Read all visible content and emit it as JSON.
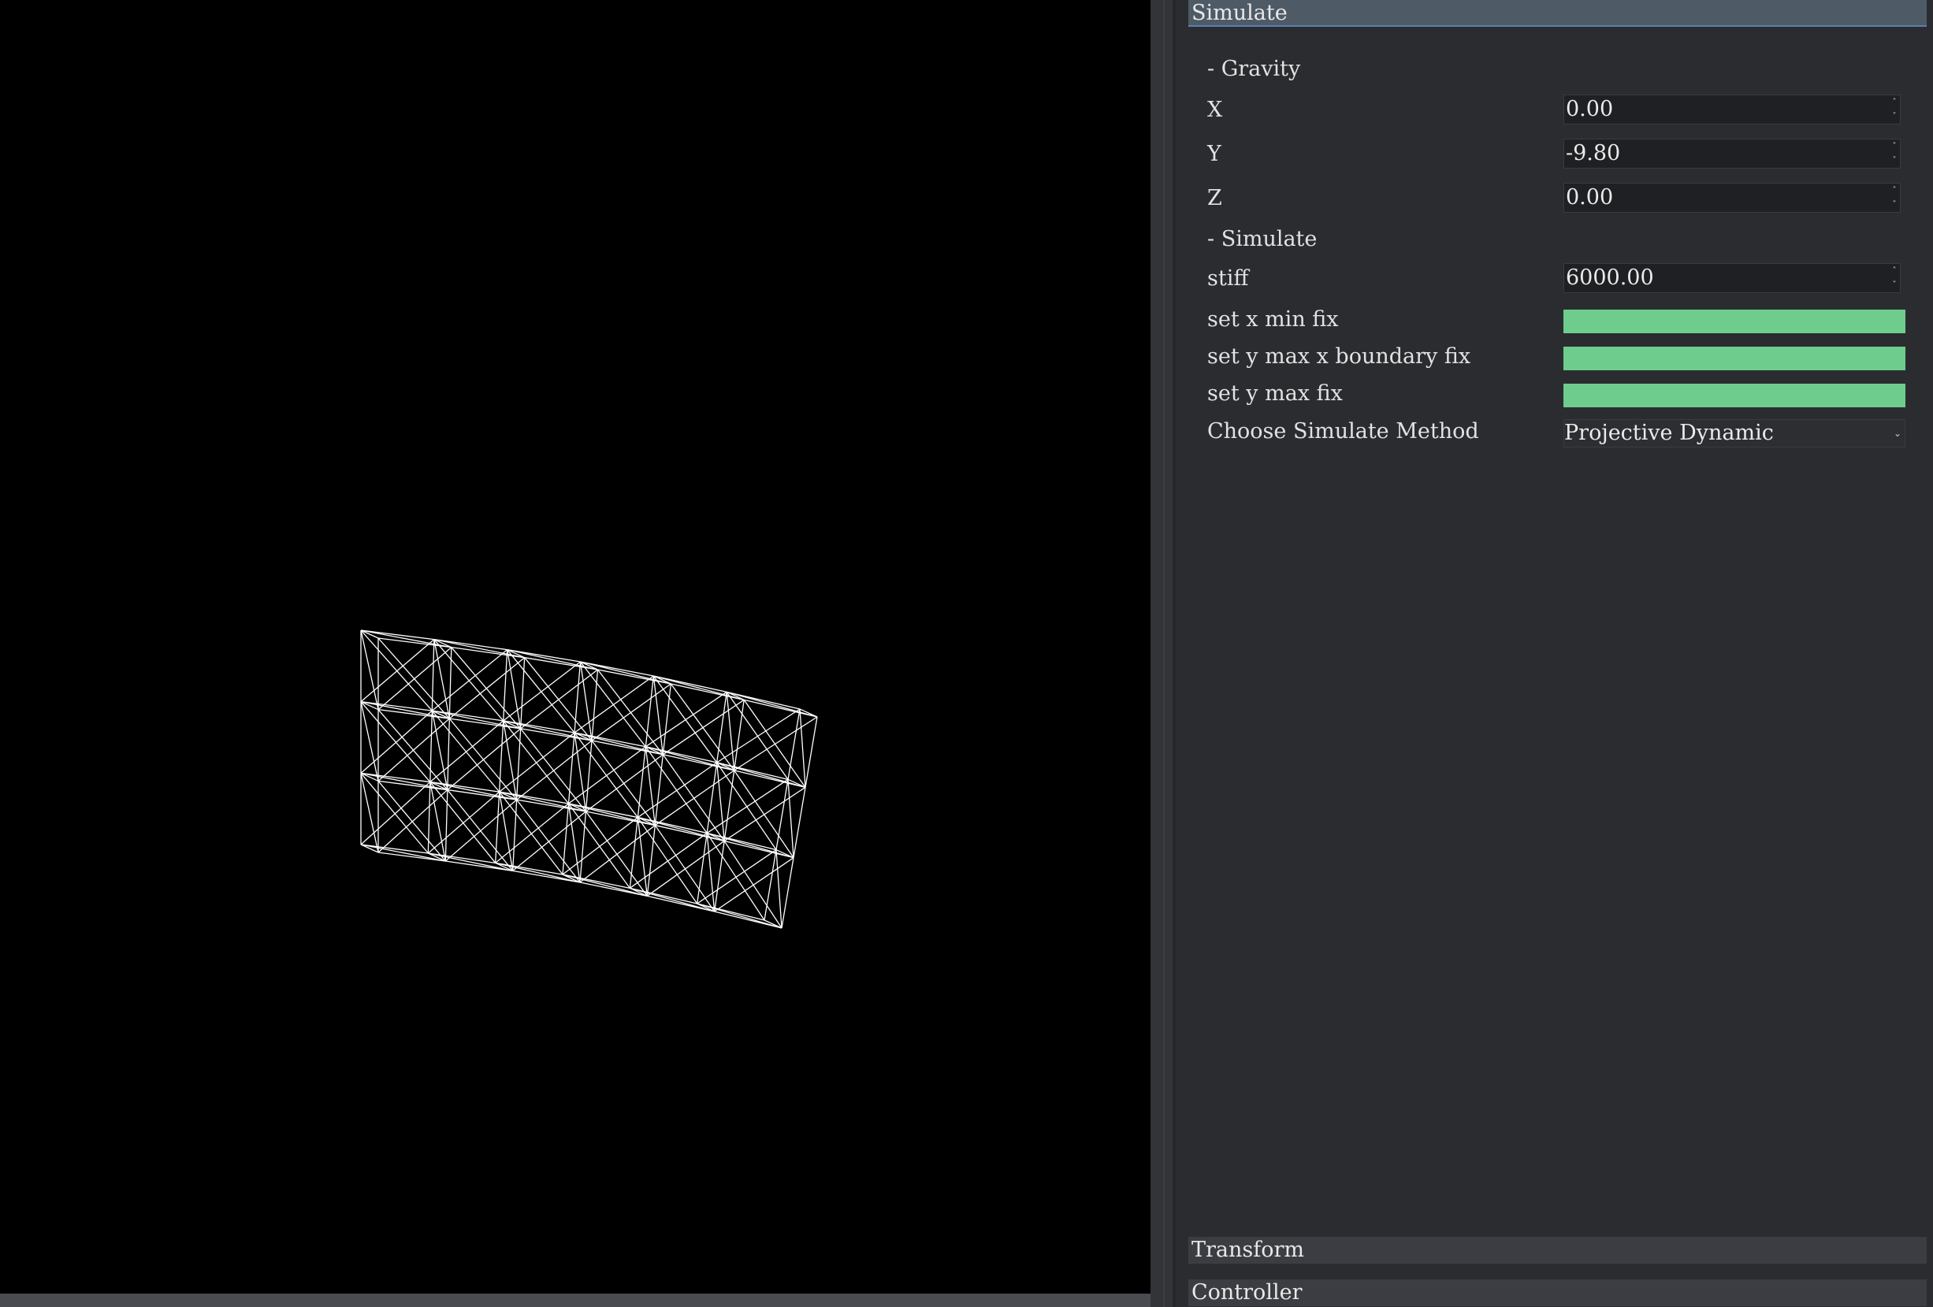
{
  "viewport": {
    "name": "3D viewport",
    "mesh_color": "#ffffff",
    "background": "#000000"
  },
  "panel": {
    "active_group": "Simulate",
    "gravity_section": "- Gravity",
    "gravity": {
      "x_label": "X",
      "x_value": "0.00",
      "y_label": "Y",
      "y_value": "-9.80",
      "z_label": "Z",
      "z_value": "0.00"
    },
    "simulate_section": "- Simulate",
    "stiff_label": "stiff",
    "stiff_value": "6000.00",
    "toggles": [
      {
        "label": "set x min fix",
        "on": true
      },
      {
        "label": "set y max x boundary fix",
        "on": true
      },
      {
        "label": "set y max fix",
        "on": true
      }
    ],
    "method_label": "Choose Simulate Method",
    "method_value": "Projective Dynamic",
    "collapsed_groups": [
      "Transform",
      "Controller"
    ]
  },
  "colors": {
    "toggle_on": "#6ecd8c",
    "header_active": "#4f5a67",
    "header_accent": "#5b7fb3"
  }
}
